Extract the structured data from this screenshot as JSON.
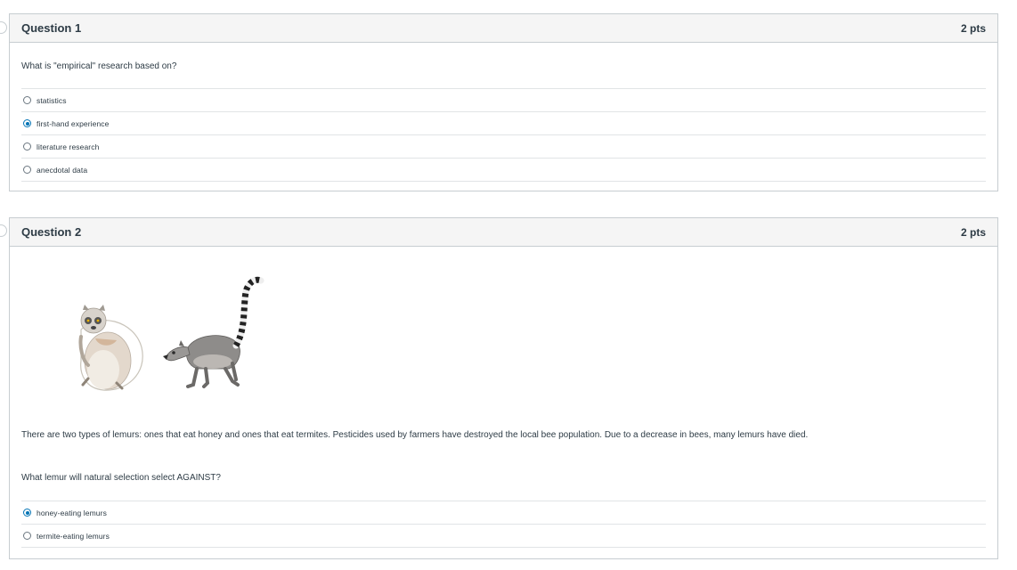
{
  "questions": [
    {
      "title": "Question 1",
      "points": "2 pts",
      "prompt": "What is \"empirical\" research based on?",
      "answers": [
        {
          "label": "statistics",
          "selected": false
        },
        {
          "label": "first-hand experience",
          "selected": true
        },
        {
          "label": "literature research",
          "selected": false
        },
        {
          "label": "anecdotal data",
          "selected": false
        }
      ]
    },
    {
      "title": "Question 2",
      "points": "2 pts",
      "passage": "There are two types of lemurs: ones that eat honey and ones that eat termites. Pesticides used by farmers have destroyed the local bee population. Due to a decrease in bees, many lemurs have died.",
      "prompt": "What lemur will natural selection select AGAINST?",
      "answers": [
        {
          "label": "honey-eating lemurs",
          "selected": true
        },
        {
          "label": "termite-eating lemurs",
          "selected": false
        }
      ]
    }
  ],
  "colors": {
    "accent": "#0374b5",
    "header_bg": "#f5f5f5",
    "border": "#c7cdd1",
    "text": "#2d3b45"
  },
  "icons": [
    "radio-button-icon",
    "lemur-illustration"
  ]
}
